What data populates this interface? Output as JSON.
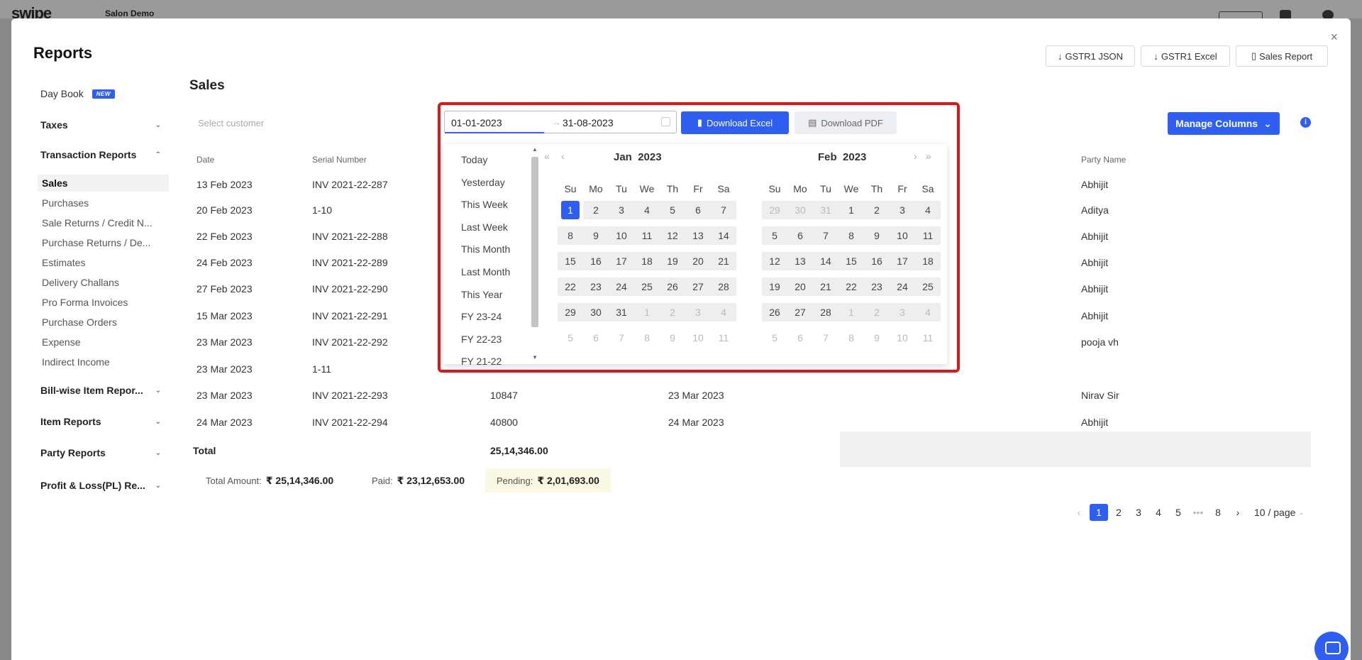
{
  "app": {
    "logo": "swipe",
    "company": "Salon Demo"
  },
  "modal": {
    "title": "Reports",
    "close": "×",
    "buttons": {
      "gstr1_json": "GSTR1 JSON",
      "gstr1_excel": "GSTR1 Excel",
      "sales_report": "Sales Report"
    }
  },
  "sidebar": {
    "day_book": "Day Book",
    "new_badge": "NEW",
    "taxes": "Taxes",
    "transaction_reports": "Transaction Reports",
    "transaction_items": [
      "Sales",
      "Purchases",
      "Sale Returns / Credit N...",
      "Purchase Returns / De...",
      "Estimates",
      "Delivery Challans",
      "Pro Forma Invoices",
      "Purchase Orders",
      "Expense",
      "Indirect Income"
    ],
    "bill_wise": "Bill-wise Item Repor...",
    "item_reports": "Item Reports",
    "party_reports": "Party Reports",
    "profit_loss": "Profit & Loss(PL) Re..."
  },
  "main": {
    "title": "Sales",
    "select_customer_placeholder": "Select customer",
    "date_start": "01-01-2023",
    "date_sep": "→",
    "date_end": "31-08-2023",
    "download_excel": "Download Excel",
    "download_pdf": "Download PDF",
    "manage_columns": "Manage Columns",
    "info": "i"
  },
  "table": {
    "headers": {
      "date": "Date",
      "serial": "Serial Number",
      "party": "Party Name"
    },
    "rows": [
      {
        "date": "13 Feb 2023",
        "serial": "INV 2021-22-287",
        "amount": "",
        "due": "",
        "party": "Abhijit"
      },
      {
        "date": "20 Feb 2023",
        "serial": "1-10",
        "amount": "",
        "due": "",
        "party": "Aditya"
      },
      {
        "date": "22 Feb 2023",
        "serial": "INV 2021-22-288",
        "amount": "",
        "due": "",
        "party": "Abhijit"
      },
      {
        "date": "24 Feb 2023",
        "serial": "INV 2021-22-289",
        "amount": "",
        "due": "",
        "party": "Abhijit"
      },
      {
        "date": "27 Feb 2023",
        "serial": "INV 2021-22-290",
        "amount": "",
        "due": "",
        "party": "Abhijit"
      },
      {
        "date": "15 Mar 2023",
        "serial": "INV 2021-22-291",
        "amount": "",
        "due": "",
        "party": "Abhijit"
      },
      {
        "date": "23 Mar 2023",
        "serial": "INV 2021-22-292",
        "amount": "",
        "due": "",
        "party": "pooja vh"
      },
      {
        "date": "23 Mar 2023",
        "serial": "1-11",
        "amount": "",
        "due": "",
        "party": ""
      },
      {
        "date": "23 Mar 2023",
        "serial": "INV 2021-22-293",
        "amount": "10847",
        "due": "23 Mar 2023",
        "party": "Nirav Sir"
      },
      {
        "date": "24 Mar 2023",
        "serial": "INV 2021-22-294",
        "amount": "40800",
        "due": "24 Mar 2023",
        "party": "Abhijit"
      }
    ],
    "total_label": "Total",
    "total_value": "25,14,346.00"
  },
  "summary": {
    "total_label": "Total Amount:",
    "total_value": "₹ 25,14,346.00",
    "paid_label": "Paid:",
    "paid_value": "₹ 23,12,653.00",
    "pending_label": "Pending:",
    "pending_value": "₹ 2,01,693.00"
  },
  "pagination": {
    "prev": "‹",
    "pages": [
      "1",
      "2",
      "3",
      "4",
      "5",
      "•••",
      "8"
    ],
    "next": "›",
    "page_size": "10 / page",
    "active": "1"
  },
  "picker": {
    "presets": [
      "Today",
      "Yesterday",
      "This Week",
      "Last Week",
      "This Month",
      "Last Month",
      "This Year",
      "FY 23-24",
      "FY 22-23",
      "FY 21-22"
    ],
    "weekdays": [
      "Su",
      "Mo",
      "Tu",
      "We",
      "Th",
      "Fr",
      "Sa"
    ],
    "left": {
      "month": "Jan",
      "year": "2023",
      "weeks": [
        [
          "1",
          "2",
          "3",
          "4",
          "5",
          "6",
          "7"
        ],
        [
          "8",
          "9",
          "10",
          "11",
          "12",
          "13",
          "14"
        ],
        [
          "15",
          "16",
          "17",
          "18",
          "19",
          "20",
          "21"
        ],
        [
          "22",
          "23",
          "24",
          "25",
          "26",
          "27",
          "28"
        ],
        [
          "29",
          "30",
          "31",
          "1",
          "2",
          "3",
          "4"
        ],
        [
          "5",
          "6",
          "7",
          "8",
          "9",
          "10",
          "11"
        ]
      ]
    },
    "right": {
      "month": "Feb",
      "year": "2023",
      "weeks": [
        [
          "29",
          "30",
          "31",
          "1",
          "2",
          "3",
          "4"
        ],
        [
          "5",
          "6",
          "7",
          "8",
          "9",
          "10",
          "11"
        ],
        [
          "12",
          "13",
          "14",
          "15",
          "16",
          "17",
          "18"
        ],
        [
          "19",
          "20",
          "21",
          "22",
          "23",
          "24",
          "25"
        ],
        [
          "26",
          "27",
          "28",
          "1",
          "2",
          "3",
          "4"
        ],
        [
          "5",
          "6",
          "7",
          "8",
          "9",
          "10",
          "11"
        ]
      ]
    },
    "nav": {
      "prev_year": "«",
      "prev_month": "‹",
      "next_month": "›",
      "next_year": "»"
    }
  }
}
